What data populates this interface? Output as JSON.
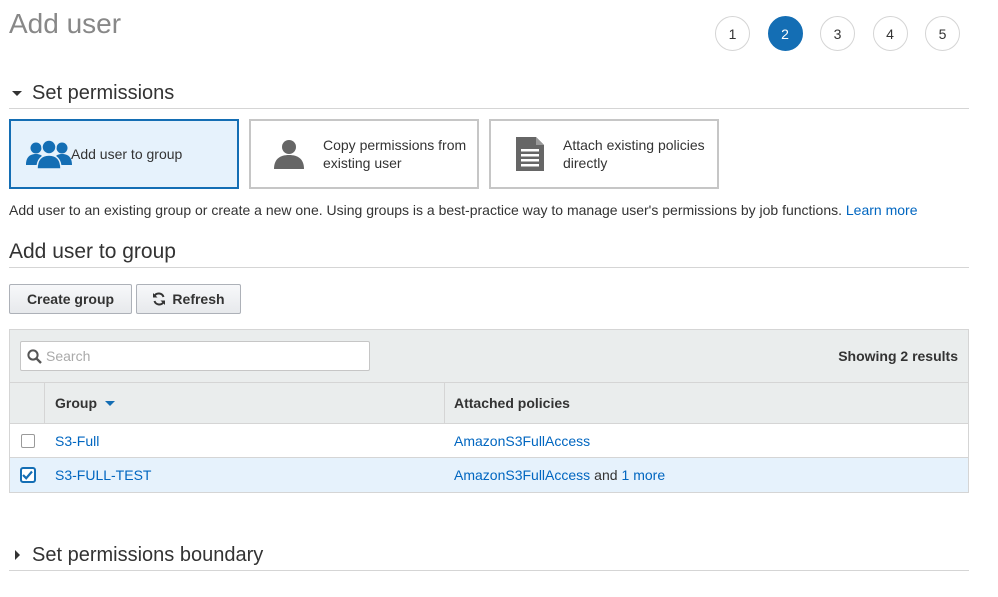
{
  "page": {
    "title": "Add user"
  },
  "steps": [
    {
      "label": "1",
      "active": false
    },
    {
      "label": "2",
      "active": true
    },
    {
      "label": "3",
      "active": false
    },
    {
      "label": "4",
      "active": false
    },
    {
      "label": "5",
      "active": false
    }
  ],
  "permissions": {
    "heading": "Set permissions",
    "options": [
      {
        "label": "Add user to group",
        "icon": "users-group-icon",
        "selected": true
      },
      {
        "label_line1": "Copy permissions from",
        "label_line2": "existing user",
        "icon": "user-icon",
        "selected": false
      },
      {
        "label_line1": "Attach existing policies",
        "label_line2": "directly",
        "icon": "document-icon",
        "selected": false
      }
    ],
    "description": "Add user to an existing group or create a new one. Using groups is a best-practice way to manage user's permissions by job functions.",
    "learn_more": "Learn more"
  },
  "group_section": {
    "heading": "Add user to group",
    "create_button": "Create group",
    "refresh_button": "Refresh",
    "search_placeholder": "Search",
    "results_text": "Showing 2 results",
    "columns": {
      "group": "Group",
      "policies": "Attached policies"
    },
    "rows": [
      {
        "group": "S3-Full",
        "policy": "AmazonS3FullAccess",
        "and_text": "",
        "more": "",
        "checked": false
      },
      {
        "group": "S3-FULL-TEST",
        "policy": "AmazonS3FullAccess",
        "and_text": "and",
        "more": "1 more",
        "checked": true
      }
    ]
  },
  "boundary": {
    "heading": "Set permissions boundary"
  },
  "colors": {
    "accent": "#146eb4",
    "link": "#0066c0",
    "selected_bg": "#e6f2fc",
    "header_bg": "#eaeded"
  }
}
